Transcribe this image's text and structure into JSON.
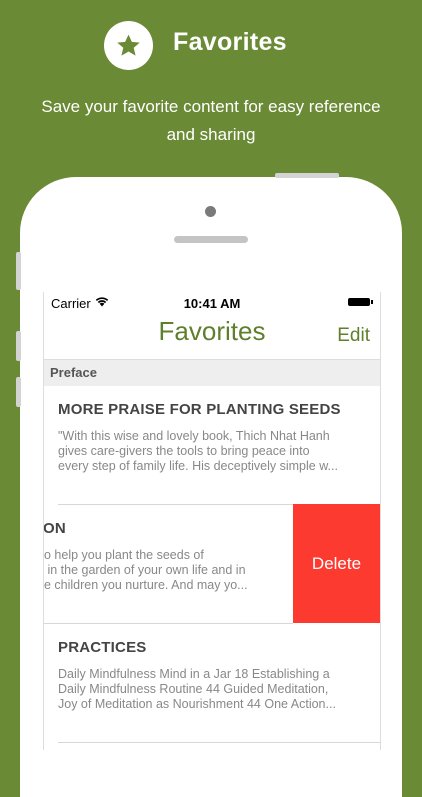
{
  "promo": {
    "title": "Favorites",
    "subtitle_line1": "Save your favorite content for easy reference",
    "subtitle_line2": "and sharing",
    "icon": "star-icon"
  },
  "status_bar": {
    "carrier": "Carrier",
    "time": "10:41 AM"
  },
  "nav": {
    "title": "Favorites",
    "edit_label": "Edit"
  },
  "section": {
    "header": "Preface"
  },
  "cells": [
    {
      "title": "MORE PRAISE FOR PLANTING SEEDS",
      "text": "\"With this wise and lovely book, Thich Nhat Hanh\ngives care-givers the tools to bring peace into\nevery step of family life. His deceptively simple w..."
    },
    {
      "title": "ON",
      "text": "o help you plant the seeds of\n in the garden of your own life and in\ne children you nurture. And may yo..."
    },
    {
      "title": "PRACTICES",
      "text": "Daily Mindfulness Mind in a Jar 18 Establishing a\nDaily Mindfulness Routine 44 Guided Meditation,\nJoy of Meditation as Nourishment 44 One Action..."
    }
  ],
  "delete_label": "Delete",
  "colors": {
    "brand_green": "#6a8a35",
    "nav_green": "#5f7f2e",
    "delete_red": "#fd3a30"
  }
}
